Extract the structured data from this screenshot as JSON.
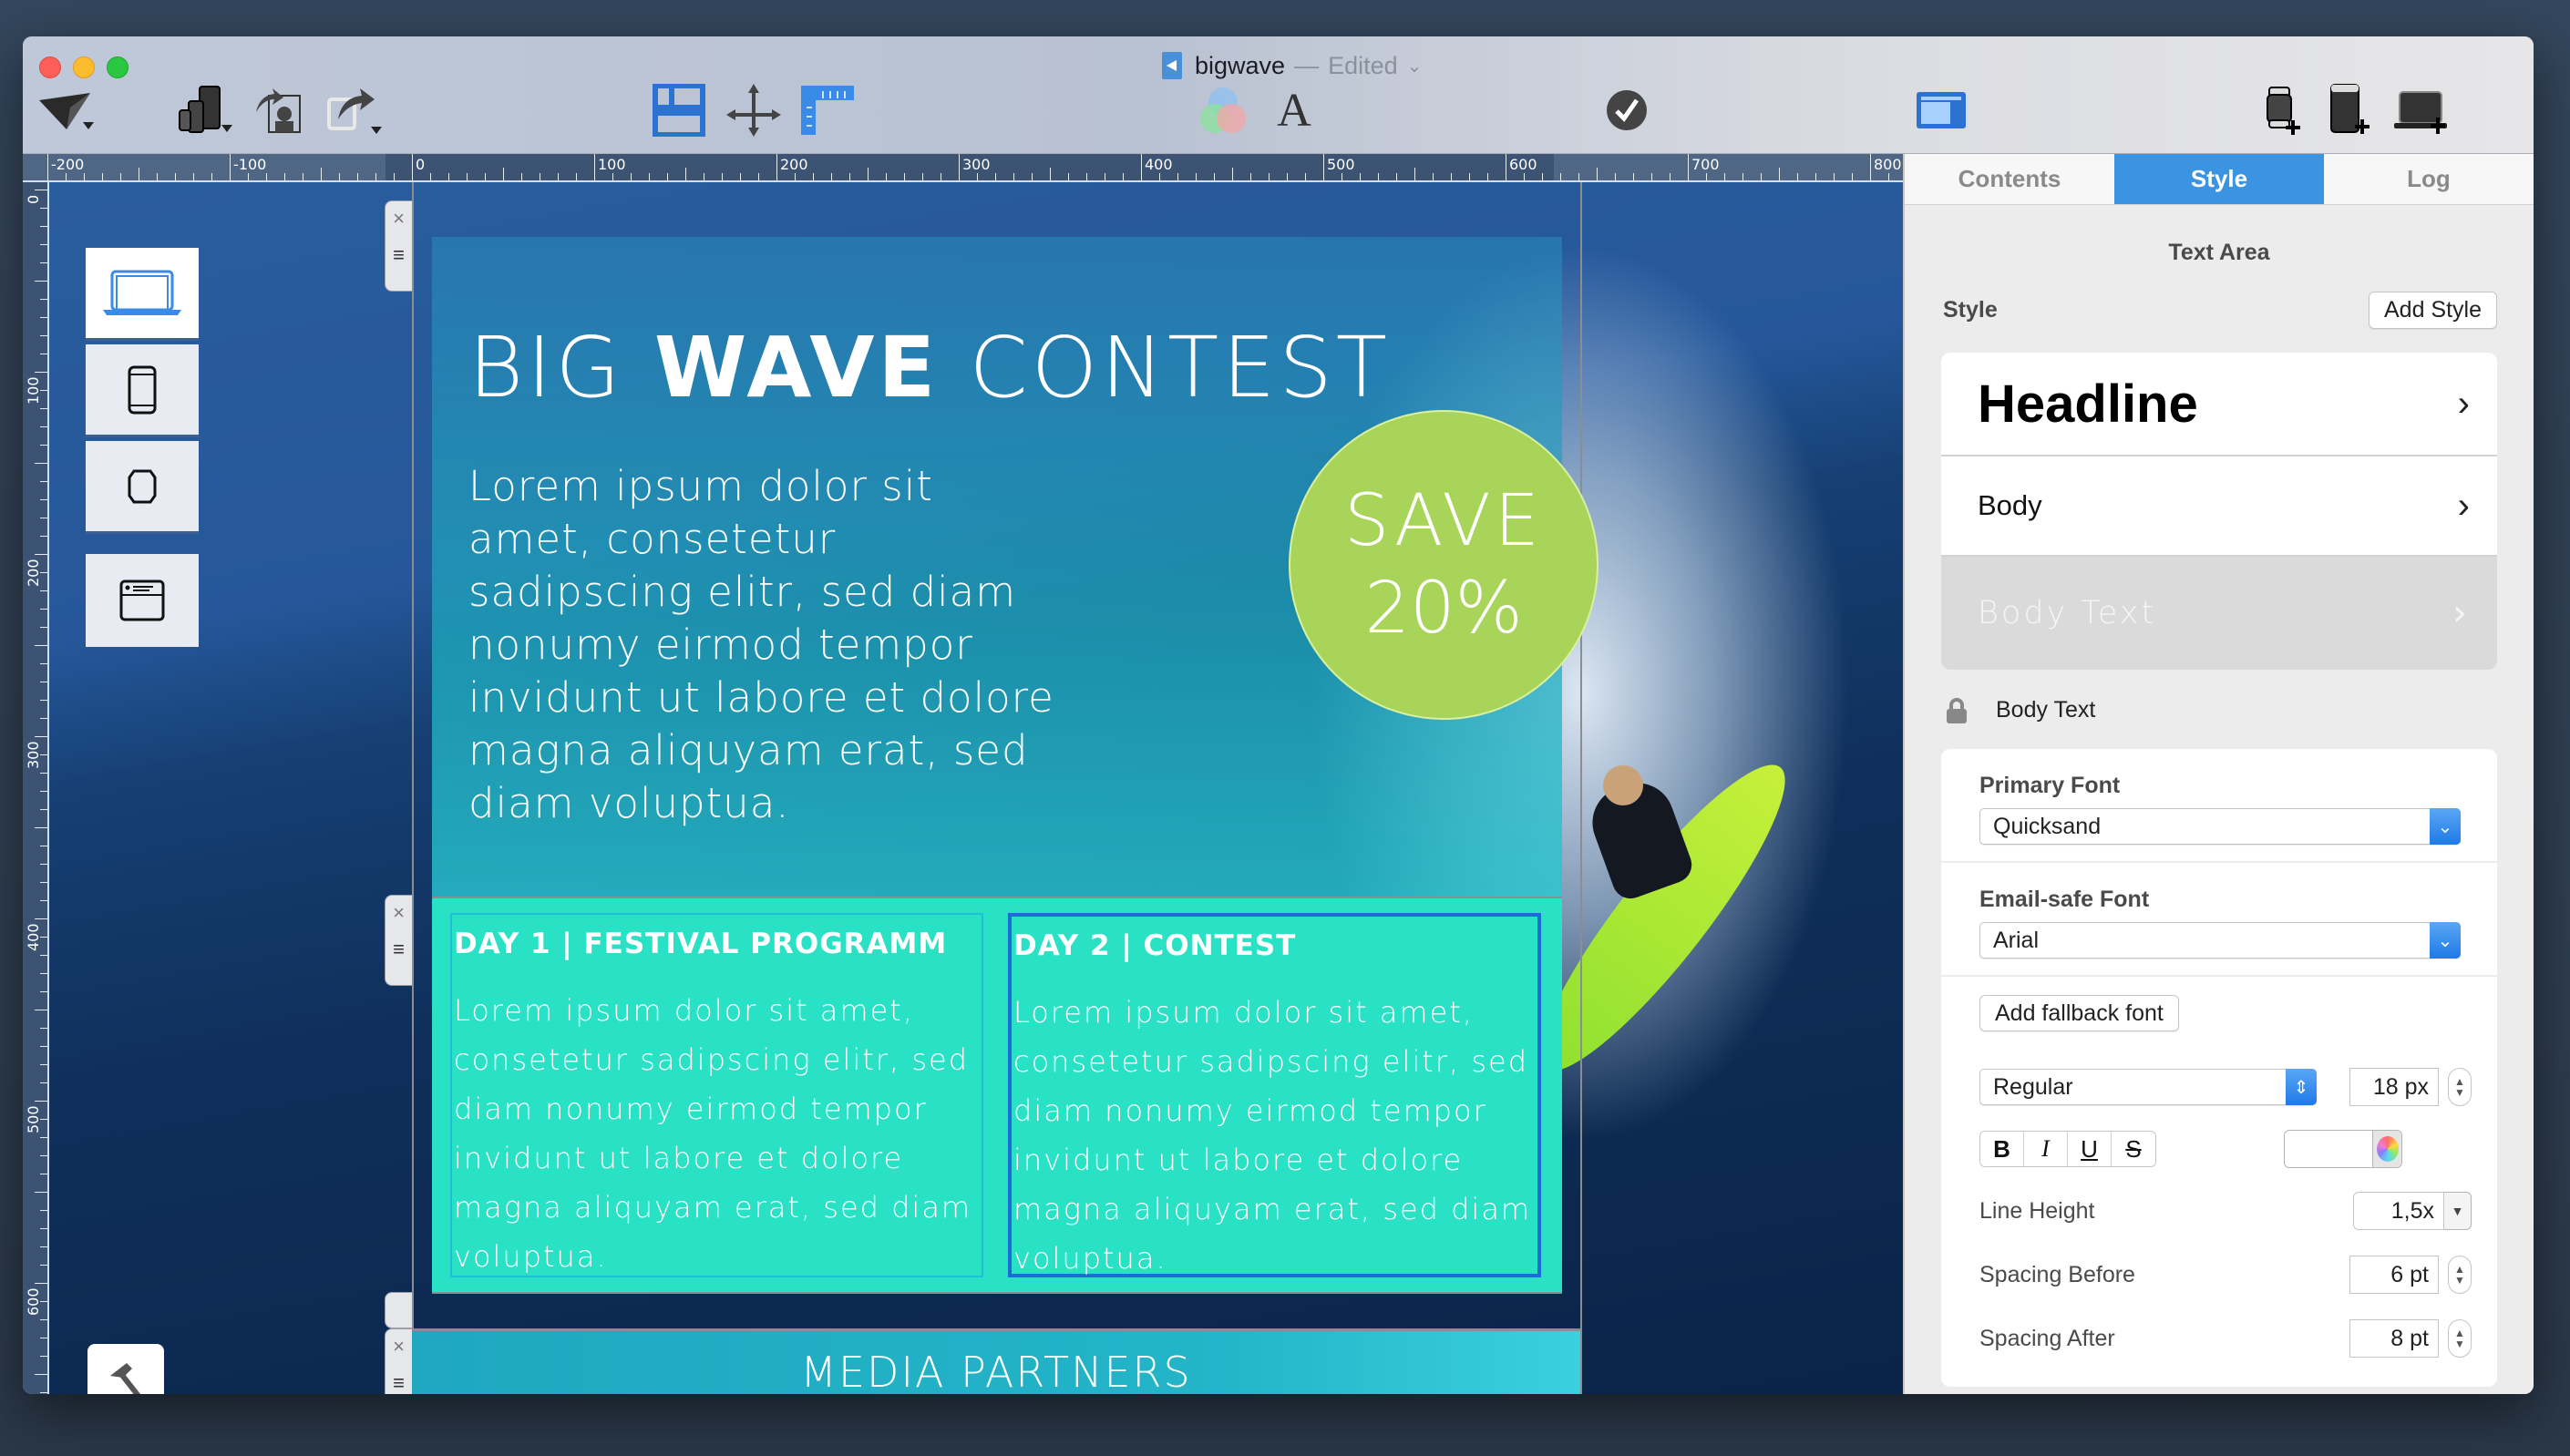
{
  "window": {
    "document_name": "bigwave",
    "separator": "—",
    "status": "Edited"
  },
  "toolbar": {
    "left_icons": [
      "send-icon",
      "preview-devices-icon",
      "share-image-icon",
      "export-icon"
    ],
    "center_icons": [
      "layout-icon",
      "move-icon",
      "ruler-icon",
      "color-mixer-icon",
      "font-icon",
      "check-icon",
      "inspector-toggle-icon"
    ],
    "right_icons": [
      "add-watch-icon",
      "add-phone-icon",
      "add-laptop-icon"
    ],
    "font_glyph": "A",
    "check_glyph": "✔"
  },
  "ruler": {
    "horizontal": [
      "-200",
      "-100",
      "0",
      "100",
      "200",
      "300",
      "400",
      "500",
      "600",
      "700",
      "800"
    ],
    "vertical": [
      "0",
      "100",
      "200",
      "300",
      "400",
      "500",
      "600"
    ]
  },
  "devices": [
    "laptop-icon",
    "phone-icon",
    "watch-icon",
    "email-icon"
  ],
  "email": {
    "hero": {
      "title_light_1": "BIG ",
      "title_bold": "WAVE",
      "title_light_2": " CONTEST",
      "body": "Lorem ipsum dolor sit amet, consetetur sadipscing elitr, sed diam nonumy eirmod tempor invidunt ut labore et dolore magna aliquyam erat, sed diam voluptua.",
      "badge_line1": "SAVE",
      "badge_line2": "20%"
    },
    "days": [
      {
        "title": "DAY 1 | FESTIVAL PROGRAMM",
        "body": "Lorem ipsum dolor sit amet, consetetur sadipscing elitr, sed diam nonumy eirmod tempor invidunt ut labore et dolore magna aliquyam erat, sed diam voluptua."
      },
      {
        "title": "DAY 2 | CONTEST",
        "body": "Lorem ipsum dolor sit amet, consetetur sadipscing elitr, sed diam nonumy eirmod tempor invidunt ut labore et dolore magna aliquyam erat, sed diam voluptua."
      }
    ],
    "media_partners": "MEDIA PARTNERS",
    "handle_close": "×",
    "handle_menu": "≡"
  },
  "sidebar": {
    "tabs": [
      {
        "label": "Contents",
        "active": false
      },
      {
        "label": "Style",
        "active": true
      },
      {
        "label": "Log",
        "active": false
      }
    ],
    "panel_title": "Text Area",
    "style_label": "Style",
    "add_style_label": "Add Style",
    "styles": [
      {
        "label": "Headline"
      },
      {
        "label": "Body"
      },
      {
        "label": "Body Text"
      }
    ],
    "chevron": "›",
    "current_style": "Body Text",
    "primary_font_label": "Primary Font",
    "primary_font_value": "Quicksand",
    "email_safe_font_label": "Email-safe Font",
    "email_safe_font_value": "Arial",
    "add_fallback_label": "Add fallback font",
    "weight_value": "Regular",
    "size_value": "18 px",
    "format_buttons": {
      "bold": "B",
      "italic": "I",
      "underline": "U",
      "strike": "S"
    },
    "line_height_label": "Line Height",
    "line_height_value": "1,5x",
    "spacing_before_label": "Spacing Before",
    "spacing_before_value": "6 pt",
    "spacing_after_label": "Spacing After",
    "spacing_after_value": "8 pt",
    "accent_color": "#3a94e2"
  }
}
